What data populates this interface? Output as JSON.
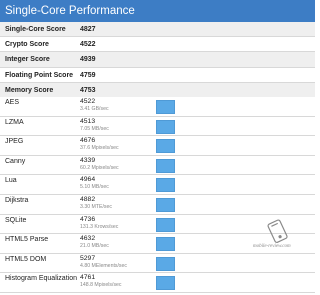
{
  "header": {
    "title": "Single-Core Performance"
  },
  "summary": [
    {
      "label": "Single-Core Score",
      "value": "4827"
    },
    {
      "label": "Crypto Score",
      "value": "4522"
    },
    {
      "label": "Integer Score",
      "value": "4939"
    },
    {
      "label": "Floating Point Score",
      "value": "4759"
    },
    {
      "label": "Memory Score",
      "value": "4753"
    }
  ],
  "tests": [
    {
      "name": "AES",
      "score": "4522",
      "detail": "3.41 GB/sec"
    },
    {
      "name": "LZMA",
      "score": "4513",
      "detail": "7.05 MB/sec"
    },
    {
      "name": "JPEG",
      "score": "4676",
      "detail": "37.6 Mpixels/sec"
    },
    {
      "name": "Canny",
      "score": "4339",
      "detail": "60.2 Mpixels/sec"
    },
    {
      "name": "Lua",
      "score": "4964",
      "detail": "5.10 MB/sec"
    },
    {
      "name": "Dijkstra",
      "score": "4882",
      "detail": "3.30 MTE/sec"
    },
    {
      "name": "SQLite",
      "score": "4736",
      "detail": "131.3 Krows/sec"
    },
    {
      "name": "HTML5 Parse",
      "score": "4632",
      "detail": "21.0 MB/sec"
    },
    {
      "name": "HTML5 DOM",
      "score": "5297",
      "detail": "4.80 MElements/sec"
    },
    {
      "name": "Histogram Equalization",
      "score": "4761",
      "detail": "148.8 Mpixels/sec"
    }
  ],
  "watermark": {
    "text": "mobile-review.com",
    "icon": "phone-logo-icon"
  },
  "colors": {
    "header": "#3d7dc5",
    "bar": "#5aa9e6",
    "shaded_row": "#efefef"
  }
}
